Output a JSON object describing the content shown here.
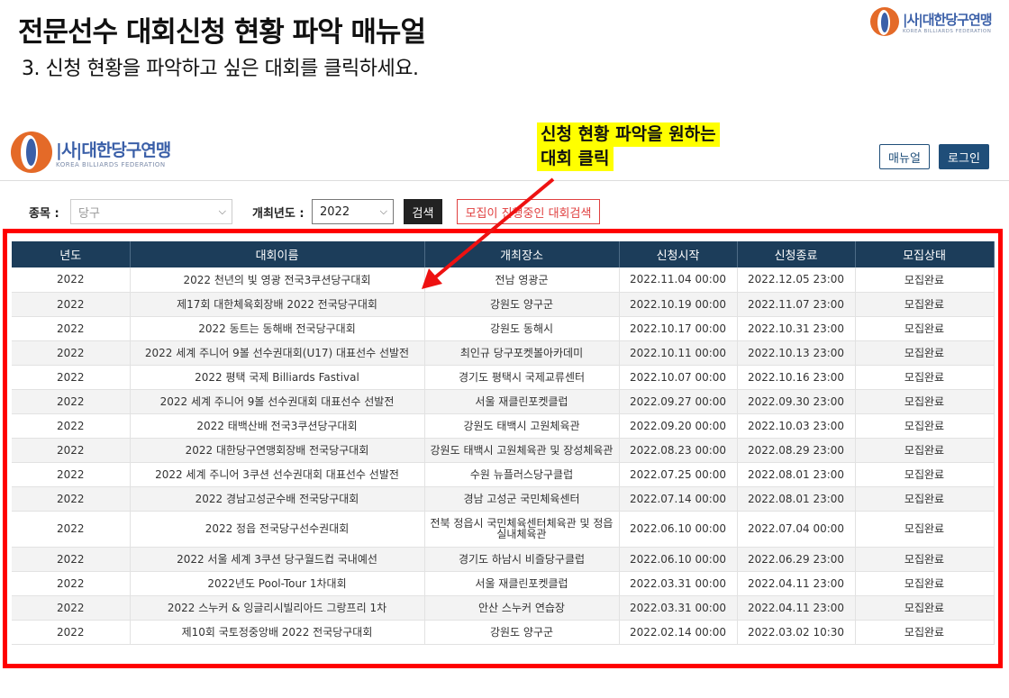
{
  "slide": {
    "title": "전문선수 대회신청 현황 파악 매뉴얼",
    "step": "3. 신청 현황을 파악하고 싶은 대회를 클릭하세요."
  },
  "logo": {
    "ko": "|사|대한당구연맹",
    "en": "KOREA BILLIARDS FEDERATION"
  },
  "annotation": {
    "line1": "신청 현황 파악을 원하는",
    "line2": "대회 클릭"
  },
  "header": {
    "manual_label": "매뉴얼",
    "login_label": "로그인"
  },
  "filters": {
    "sport_label": "종목 :",
    "sport_value": "당구",
    "year_label": "개최년도 :",
    "year_value": "2022",
    "search_label": "검색",
    "open_search_label": "모집이 진행중인 대회검색"
  },
  "colors": {
    "accent": "#1c3d5a",
    "highlight": "#ff0000",
    "annotation_bg": "#ffff00"
  },
  "table": {
    "headers": [
      "년도",
      "대회이름",
      "개최장소",
      "신청시작",
      "신청종료",
      "모집상태"
    ],
    "rows": [
      [
        "2022",
        "2022 천년의 빛 영광 전국3쿠션당구대회",
        "전남 영광군",
        "2022.11.04 00:00",
        "2022.12.05 23:00",
        "모집완료"
      ],
      [
        "2022",
        "제17회 대한체육회장배 2022 전국당구대회",
        "강원도 양구군",
        "2022.10.19 00:00",
        "2022.11.07 23:00",
        "모집완료"
      ],
      [
        "2022",
        "2022 동트는 동해배 전국당구대회",
        "강원도 동해시",
        "2022.10.17 00:00",
        "2022.10.31 23:00",
        "모집완료"
      ],
      [
        "2022",
        "2022 세계 주니어 9볼 선수권대회(U17) 대표선수 선발전",
        "최인규 당구포켓볼아카데미",
        "2022.10.11 00:00",
        "2022.10.13 23:00",
        "모집완료"
      ],
      [
        "2022",
        "2022 평택 국제 Billiards Fastival",
        "경기도 평택시 국제교류센터",
        "2022.10.07 00:00",
        "2022.10.16 23:00",
        "모집완료"
      ],
      [
        "2022",
        "2022 세계 주니어 9볼 선수권대회 대표선수 선발전",
        "서울 재클린포켓클럽",
        "2022.09.27 00:00",
        "2022.09.30 23:00",
        "모집완료"
      ],
      [
        "2022",
        "2022 태백산배 전국3쿠션당구대회",
        "강원도 태백시 고원체육관",
        "2022.09.20 00:00",
        "2022.10.03 23:00",
        "모집완료"
      ],
      [
        "2022",
        "2022 대한당구연맹회장배 전국당구대회",
        "강원도 태백시 고원체육관 및 장성체육관",
        "2022.08.23 00:00",
        "2022.08.29 23:00",
        "모집완료"
      ],
      [
        "2022",
        "2022 세계 주니어 3쿠션 선수권대회 대표선수 선발전",
        "수원 뉴플러스당구클럽",
        "2022.07.25 00:00",
        "2022.08.01 23:00",
        "모집완료"
      ],
      [
        "2022",
        "2022 경남고성군수배 전국당구대회",
        "경남 고성군 국민체육센터",
        "2022.07.14 00:00",
        "2022.08.01 23:00",
        "모집완료"
      ],
      [
        "2022",
        "2022 정읍 전국당구선수권대회",
        "전북 정읍시 국민체육센터체육관 및 정읍실내체육관",
        "2022.06.10 00:00",
        "2022.07.04 00:00",
        "모집완료"
      ],
      [
        "2022",
        "2022 서울 세계 3쿠션 당구월드컵 국내예선",
        "경기도 하남시 비즐당구클럽",
        "2022.06.10 00:00",
        "2022.06.29 23:00",
        "모집완료"
      ],
      [
        "2022",
        "2022년도 Pool-Tour 1차대회",
        "서울 재클린포켓클럽",
        "2022.03.31 00:00",
        "2022.04.11 23:00",
        "모집완료"
      ],
      [
        "2022",
        "2022 스누커 & 잉글리시빌리아드 그랑프리 1차",
        "안산 스누커 연습장",
        "2022.03.31 00:00",
        "2022.04.11 23:00",
        "모집완료"
      ],
      [
        "2022",
        "제10회 국토정중앙배 2022 전국당구대회",
        "강원도 양구군",
        "2022.02.14 00:00",
        "2022.03.02 10:30",
        "모집완료"
      ]
    ]
  }
}
